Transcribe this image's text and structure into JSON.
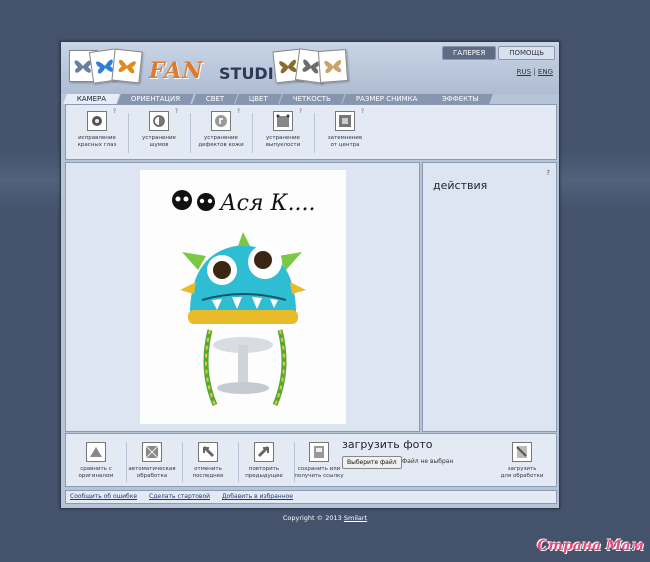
{
  "logo": {
    "fan": "FAN",
    "studio": "STUDIO"
  },
  "top_tabs": [
    "ГАЛЕРЕЯ",
    "ПОМОЩЬ"
  ],
  "lang": [
    "RUS",
    "ENG"
  ],
  "category_tabs": [
    "КАМЕРА",
    "ОРИЕНТАЦИЯ",
    "СВЕТ",
    "ЦВЕТ",
    "ЧЕТКОСТЬ",
    "РАЗМЕР СНИМКА",
    "ЭФФЕКТЫ"
  ],
  "tools": [
    {
      "line1": "исправление",
      "line2": "красных глаз",
      "icon": "red-eye-icon"
    },
    {
      "line1": "устранение",
      "line2": "шумов",
      "icon": "noise-icon"
    },
    {
      "line1": "устранение",
      "line2": "дефектов кожи",
      "icon": "skin-icon"
    },
    {
      "line1": "устранение",
      "line2": "выпуклости",
      "icon": "bulge-icon"
    },
    {
      "line1": "затемнение",
      "line2": "от центра",
      "icon": "vignette-icon"
    }
  ],
  "tool_help": "?",
  "actions": {
    "title": "действия",
    "help": "?"
  },
  "photo": {
    "caption": "Ася К...."
  },
  "bottom_tools": [
    {
      "line1": "сравнить с",
      "line2": "оригиналом",
      "icon": "compare-icon"
    },
    {
      "line1": "автоматическая",
      "line2": "обработка",
      "icon": "auto-icon"
    },
    {
      "line1": "отменить",
      "line2": "последнее",
      "icon": "undo-icon"
    },
    {
      "line1": "повторить",
      "line2": "предыдущее",
      "icon": "redo-icon"
    },
    {
      "line1": "сохранить или",
      "line2": "получить ссылку",
      "icon": "save-icon"
    }
  ],
  "upload": {
    "title": "загрузить фото",
    "button": "Выберите файл",
    "status": "Файл не выбран",
    "process_line1": "загрузить",
    "process_line2": "для обработки"
  },
  "footer_links": [
    "Сообщить об ошибке",
    "Сделать стартовой",
    "Добавить в избранное"
  ],
  "copyright": {
    "text": "Copyright © 2013",
    "brand": "Smilart"
  },
  "watermark": "Страна Мам"
}
